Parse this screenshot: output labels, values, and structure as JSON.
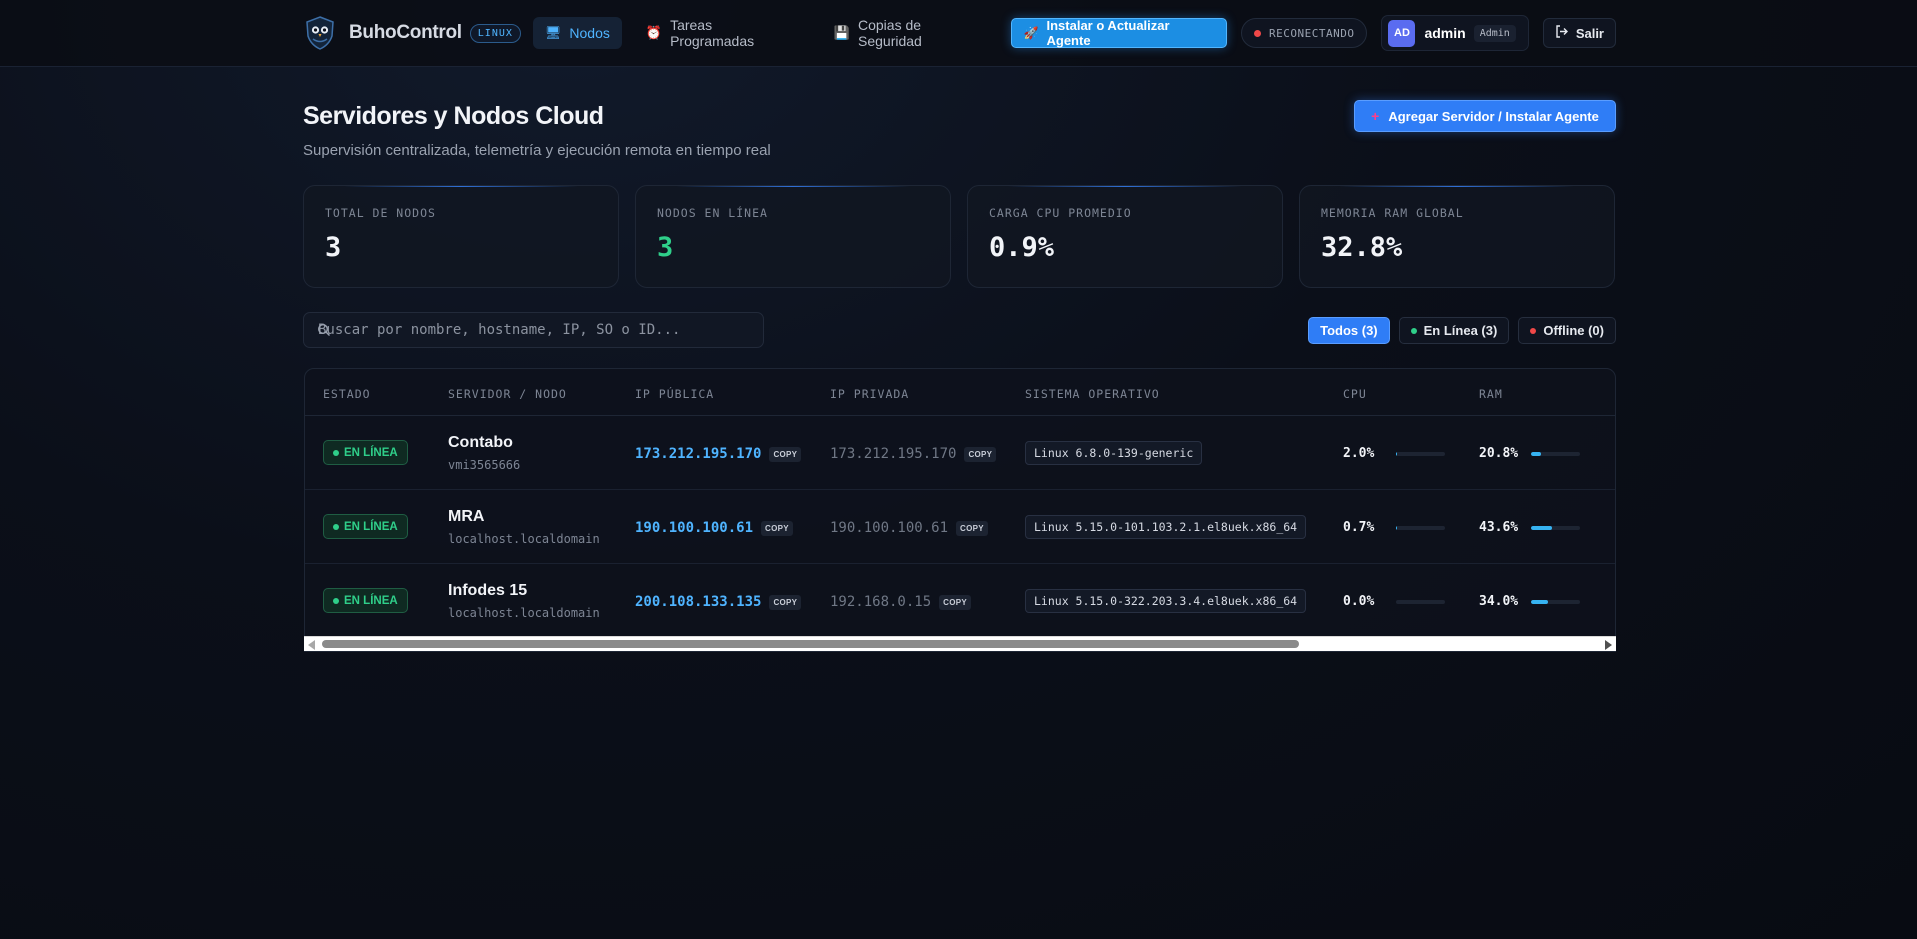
{
  "app": {
    "name": "BuhoControl",
    "platform_tag": "LINUX"
  },
  "nav": {
    "items": [
      {
        "label": "Nodos",
        "icon": "monitor-icon",
        "active": true
      },
      {
        "label": "Tareas Programadas",
        "icon": "alarm-clock-icon",
        "active": false
      },
      {
        "label": "Copias de Seguridad",
        "icon": "floppy-disk-icon",
        "active": false
      }
    ],
    "install_label": "Instalar o Actualizar Agente",
    "connection_status": "RECONECTANDO",
    "user": {
      "initials": "AD",
      "name": "admin",
      "role": "Admin"
    },
    "logout_label": "Salir"
  },
  "header": {
    "title": "Servidores y Nodos Cloud",
    "subtitle": "Supervisión centralizada, telemetría y ejecución remota en tiempo real",
    "add_label": "Agregar Servidor / Instalar Agente"
  },
  "stats": [
    {
      "label": "TOTAL DE NODOS",
      "value": "3"
    },
    {
      "label": "NODOS EN LÍNEA",
      "value": "3"
    },
    {
      "label": "CARGA CPU PROMEDIO",
      "value": "0.9%"
    },
    {
      "label": "MEMORIA RAM GLOBAL",
      "value": "32.8%"
    }
  ],
  "search": {
    "placeholder": "Buscar por nombre, hostname, IP, SO o ID..."
  },
  "filters": [
    {
      "label": "Todos (3)",
      "active": true
    },
    {
      "label": "En Línea (3)",
      "dot_color": "#2fcf8a"
    },
    {
      "label": "Offline (0)",
      "dot_color": "#f04848"
    }
  ],
  "table": {
    "columns": [
      "ESTADO",
      "SERVIDOR / NODO",
      "IP PÚBLICA",
      "IP PRIVADA",
      "SISTEMA OPERATIVO",
      "CPU",
      "RAM"
    ],
    "copy_label": "COPY",
    "rows": [
      {
        "status": "EN LÍNEA",
        "name": "Contabo",
        "hostname": "vmi3565666",
        "ip_public": "173.212.195.170",
        "ip_private": "173.212.195.170",
        "os": "Linux 6.8.0-139-generic",
        "cpu": "2.0%",
        "cpu_pct": 2.0,
        "ram": "20.8%",
        "ram_pct": 20.8
      },
      {
        "status": "EN LÍNEA",
        "name": "MRA",
        "hostname": "localhost.localdomain",
        "ip_public": "190.100.100.61",
        "ip_private": "190.100.100.61",
        "os": "Linux 5.15.0-101.103.2.1.el8uek.x86_64",
        "cpu": "0.7%",
        "cpu_pct": 0.7,
        "ram": "43.6%",
        "ram_pct": 43.6
      },
      {
        "status": "EN LÍNEA",
        "name": "Infodes 15",
        "hostname": "localhost.localdomain",
        "ip_public": "200.108.133.135",
        "ip_private": "192.168.0.15",
        "os": "Linux 5.15.0-322.203.3.4.el8uek.x86_64",
        "cpu": "0.0%",
        "cpu_pct": 0.0,
        "ram": "34.0%",
        "ram_pct": 34.0
      }
    ]
  },
  "colors": {
    "accent": "#4fb4ff",
    "primary_button": "#2f7df6",
    "online": "#2fcf8a",
    "offline": "#f04848"
  }
}
